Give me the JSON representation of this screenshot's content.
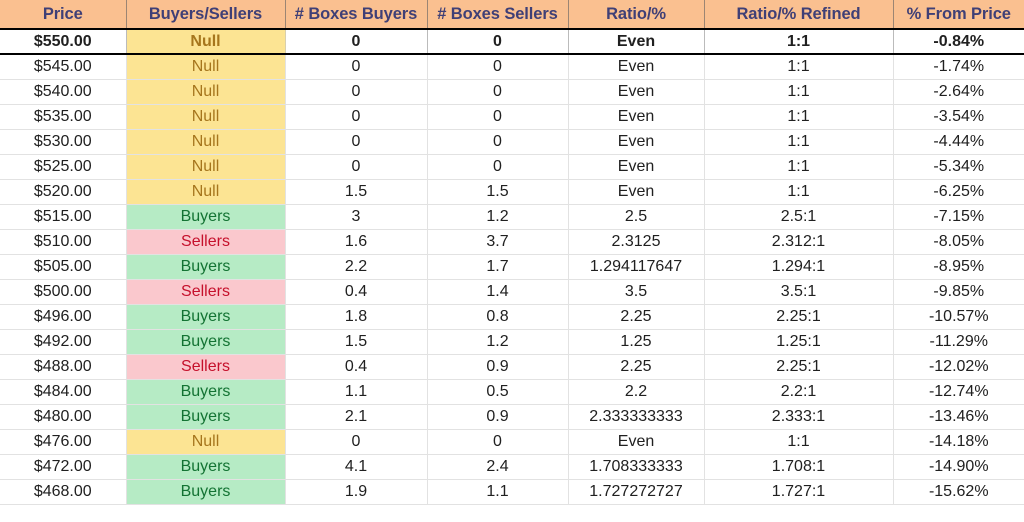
{
  "table": {
    "name": "order-flow-levels-table",
    "columns": [
      "Price",
      "Buyers/Sellers",
      "# Boxes Buyers",
      "# Boxes Sellers",
      "Ratio/%",
      "Ratio/% Refined",
      "% From Price"
    ],
    "selected_row_index": 0,
    "colors": {
      "header_background": "#FAC090",
      "header_text": "#3F3F76",
      "null_background": "#FCE493",
      "null_text": "#A6761D",
      "buyers_background": "#B6EBC5",
      "buyers_text": "#137333",
      "sellers_background": "#FAC8CD",
      "sellers_text": "#C5102B",
      "grid_line": "#E2E2E2",
      "selection_border": "#000000"
    },
    "rows": [
      {
        "price": "$550.00",
        "signal": "Null",
        "signal_kind": "null",
        "boxes_buyers": "0",
        "boxes_sellers": "0",
        "ratio": "Even",
        "ratio_refined": "1:1",
        "pct_from_price": "-0.84%"
      },
      {
        "price": "$545.00",
        "signal": "Null",
        "signal_kind": "null",
        "boxes_buyers": "0",
        "boxes_sellers": "0",
        "ratio": "Even",
        "ratio_refined": "1:1",
        "pct_from_price": "-1.74%"
      },
      {
        "price": "$540.00",
        "signal": "Null",
        "signal_kind": "null",
        "boxes_buyers": "0",
        "boxes_sellers": "0",
        "ratio": "Even",
        "ratio_refined": "1:1",
        "pct_from_price": "-2.64%"
      },
      {
        "price": "$535.00",
        "signal": "Null",
        "signal_kind": "null",
        "boxes_buyers": "0",
        "boxes_sellers": "0",
        "ratio": "Even",
        "ratio_refined": "1:1",
        "pct_from_price": "-3.54%"
      },
      {
        "price": "$530.00",
        "signal": "Null",
        "signal_kind": "null",
        "boxes_buyers": "0",
        "boxes_sellers": "0",
        "ratio": "Even",
        "ratio_refined": "1:1",
        "pct_from_price": "-4.44%"
      },
      {
        "price": "$525.00",
        "signal": "Null",
        "signal_kind": "null",
        "boxes_buyers": "0",
        "boxes_sellers": "0",
        "ratio": "Even",
        "ratio_refined": "1:1",
        "pct_from_price": "-5.34%"
      },
      {
        "price": "$520.00",
        "signal": "Null",
        "signal_kind": "null",
        "boxes_buyers": "1.5",
        "boxes_sellers": "1.5",
        "ratio": "Even",
        "ratio_refined": "1:1",
        "pct_from_price": "-6.25%"
      },
      {
        "price": "$515.00",
        "signal": "Buyers",
        "signal_kind": "buyers",
        "boxes_buyers": "3",
        "boxes_sellers": "1.2",
        "ratio": "2.5",
        "ratio_refined": "2.5:1",
        "pct_from_price": "-7.15%"
      },
      {
        "price": "$510.00",
        "signal": "Sellers",
        "signal_kind": "sellers",
        "boxes_buyers": "1.6",
        "boxes_sellers": "3.7",
        "ratio": "2.3125",
        "ratio_refined": "2.312:1",
        "pct_from_price": "-8.05%"
      },
      {
        "price": "$505.00",
        "signal": "Buyers",
        "signal_kind": "buyers",
        "boxes_buyers": "2.2",
        "boxes_sellers": "1.7",
        "ratio": "1.294117647",
        "ratio_refined": "1.294:1",
        "pct_from_price": "-8.95%"
      },
      {
        "price": "$500.00",
        "signal": "Sellers",
        "signal_kind": "sellers",
        "boxes_buyers": "0.4",
        "boxes_sellers": "1.4",
        "ratio": "3.5",
        "ratio_refined": "3.5:1",
        "pct_from_price": "-9.85%"
      },
      {
        "price": "$496.00",
        "signal": "Buyers",
        "signal_kind": "buyers",
        "boxes_buyers": "1.8",
        "boxes_sellers": "0.8",
        "ratio": "2.25",
        "ratio_refined": "2.25:1",
        "pct_from_price": "-10.57%"
      },
      {
        "price": "$492.00",
        "signal": "Buyers",
        "signal_kind": "buyers",
        "boxes_buyers": "1.5",
        "boxes_sellers": "1.2",
        "ratio": "1.25",
        "ratio_refined": "1.25:1",
        "pct_from_price": "-11.29%"
      },
      {
        "price": "$488.00",
        "signal": "Sellers",
        "signal_kind": "sellers",
        "boxes_buyers": "0.4",
        "boxes_sellers": "0.9",
        "ratio": "2.25",
        "ratio_refined": "2.25:1",
        "pct_from_price": "-12.02%"
      },
      {
        "price": "$484.00",
        "signal": "Buyers",
        "signal_kind": "buyers",
        "boxes_buyers": "1.1",
        "boxes_sellers": "0.5",
        "ratio": "2.2",
        "ratio_refined": "2.2:1",
        "pct_from_price": "-12.74%"
      },
      {
        "price": "$480.00",
        "signal": "Buyers",
        "signal_kind": "buyers",
        "boxes_buyers": "2.1",
        "boxes_sellers": "0.9",
        "ratio": "2.333333333",
        "ratio_refined": "2.333:1",
        "pct_from_price": "-13.46%"
      },
      {
        "price": "$476.00",
        "signal": "Null",
        "signal_kind": "null",
        "boxes_buyers": "0",
        "boxes_sellers": "0",
        "ratio": "Even",
        "ratio_refined": "1:1",
        "pct_from_price": "-14.18%"
      },
      {
        "price": "$472.00",
        "signal": "Buyers",
        "signal_kind": "buyers",
        "boxes_buyers": "4.1",
        "boxes_sellers": "2.4",
        "ratio": "1.708333333",
        "ratio_refined": "1.708:1",
        "pct_from_price": "-14.90%"
      },
      {
        "price": "$468.00",
        "signal": "Buyers",
        "signal_kind": "buyers",
        "boxes_buyers": "1.9",
        "boxes_sellers": "1.1",
        "ratio": "1.727272727",
        "ratio_refined": "1.727:1",
        "pct_from_price": "-15.62%"
      }
    ]
  }
}
